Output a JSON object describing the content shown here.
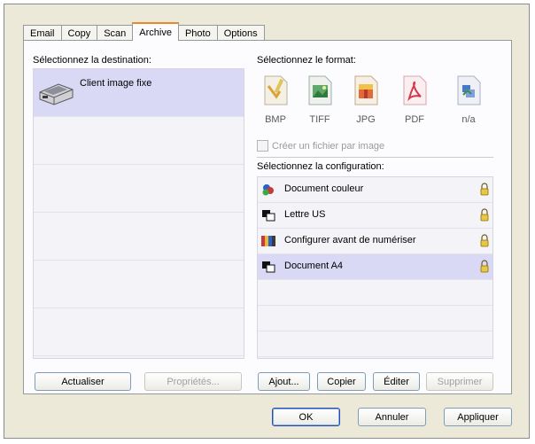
{
  "tabs": [
    {
      "label": "Email"
    },
    {
      "label": "Copy"
    },
    {
      "label": "Scan"
    },
    {
      "label": "Archive",
      "active": true
    },
    {
      "label": "Photo"
    },
    {
      "label": "Options"
    }
  ],
  "destination": {
    "heading": "Sélectionnez la destination:",
    "items": [
      {
        "label": "Client image fixe",
        "icon": "scanner-icon",
        "selected": true
      }
    ],
    "refresh_button": "Actualiser",
    "properties_button": "Propriétés..."
  },
  "format": {
    "heading": "Sélectionnez le format:",
    "items": [
      {
        "label": "BMP",
        "icon": "bmp-file-icon"
      },
      {
        "label": "TIFF",
        "icon": "tiff-file-icon"
      },
      {
        "label": "JPG",
        "icon": "jpg-file-icon"
      },
      {
        "label": "PDF",
        "icon": "pdf-file-icon"
      },
      {
        "label": "n/a",
        "icon": "na-file-icon"
      }
    ],
    "checkbox_label": "Créer un fichier par image",
    "checkbox_checked": false
  },
  "configuration": {
    "heading": "Sélectionnez la configuration:",
    "items": [
      {
        "label": "Document couleur",
        "icon": "color-document-icon",
        "lock": "lock-icon"
      },
      {
        "label": "Lettre US",
        "icon": "bw-document-icon",
        "lock": "lock-icon"
      },
      {
        "label": "Configurer avant de numériser",
        "icon": "configure-icon",
        "lock": "lock-icon"
      },
      {
        "label": "Document A4",
        "icon": "bw-document-icon",
        "lock": "lock-icon",
        "selected": true
      }
    ],
    "add_button": "Ajout...",
    "copy_button": "Copier",
    "edit_button": "Éditer",
    "delete_button": "Supprimer"
  },
  "footer": {
    "ok_button": "OK",
    "cancel_button": "Annuler",
    "apply_button": "Appliquer"
  },
  "colors": {
    "selection": "#d9d9f5",
    "active_tab_accent": "#e68b2c",
    "dialog_background": "#ece9d8"
  }
}
